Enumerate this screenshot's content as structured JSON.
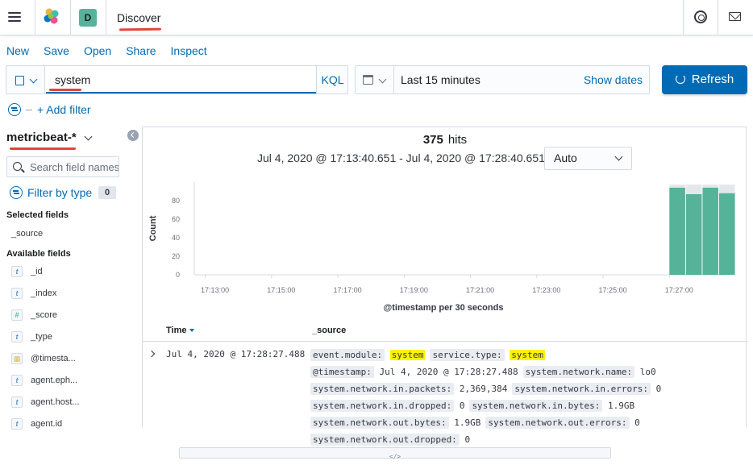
{
  "header": {
    "breadcrumb": "Discover",
    "space_initial": "D"
  },
  "toolbar": {
    "new": "New",
    "save": "Save",
    "open": "Open",
    "share": "Share",
    "inspect": "Inspect"
  },
  "query": {
    "value": "system",
    "language": "KQL"
  },
  "time": {
    "range": "Last 15 minutes",
    "show_dates": "Show dates",
    "refresh": "Refresh"
  },
  "filters": {
    "add": "+ Add filter"
  },
  "sidebar": {
    "index_pattern": "metricbeat-*",
    "search_placeholder": "Search field names",
    "filter_by_type": "Filter by type",
    "filter_count": "0",
    "selected_heading": "Selected fields",
    "available_heading": "Available fields",
    "selected": [
      {
        "name": "_source",
        "type": "source"
      }
    ],
    "available": [
      {
        "name": "_id",
        "type": "t"
      },
      {
        "name": "_index",
        "type": "t"
      },
      {
        "name": "_score",
        "type": "#"
      },
      {
        "name": "_type",
        "type": "t"
      },
      {
        "name": "@timesta...",
        "type": "date"
      },
      {
        "name": "agent.eph...",
        "type": "t"
      },
      {
        "name": "agent.host...",
        "type": "t"
      },
      {
        "name": "agent.id",
        "type": "t"
      }
    ]
  },
  "results": {
    "hits_count": "375",
    "hits_label": "hits",
    "date_range": "Jul 4, 2020 @ 17:13:40.651 - Jul 4, 2020 @ 17:28:40.651 —",
    "interval": "Auto"
  },
  "colors": {
    "bar": "#54b399",
    "bar_bg": "#e4e8ed",
    "accent": "#006bb4"
  },
  "chart_data": {
    "type": "bar",
    "ylabel": "Count",
    "xlabel": "@timestamp per 30 seconds",
    "y_ticks": [
      0,
      20,
      40,
      60,
      80
    ],
    "ylim": [
      0,
      100
    ],
    "x_ticks": [
      "17:13:00",
      "17:15:00",
      "17:17:00",
      "17:19:00",
      "17:21:00",
      "17:23:00",
      "17:25:00",
      "17:27:00"
    ],
    "x_range_minutes": [
      12.67,
      28.67
    ],
    "bars": [
      {
        "x": 27.0,
        "value": 94
      },
      {
        "x": 27.5,
        "value": 87
      },
      {
        "x": 28.0,
        "value": 94
      },
      {
        "x": 28.5,
        "value": 88
      }
    ]
  },
  "table": {
    "col_time": "Time",
    "col_source": "_source",
    "rows": [
      {
        "time": "Jul 4, 2020 @ 17:28:27.488",
        "fields": [
          {
            "k": "event.module:",
            "v": "system",
            "hl": true
          },
          {
            "k": "service.type:",
            "v": "system",
            "hl": true
          },
          {
            "k": "@timestamp:",
            "v": "Jul 4, 2020 @ 17:28:27.488",
            "hl": false
          },
          {
            "k": "system.network.name:",
            "v": "lo0",
            "hl": false
          },
          {
            "k": "system.network.in.packets:",
            "v": "2,369,384",
            "hl": false
          },
          {
            "k": "system.network.in.errors:",
            "v": "0",
            "hl": false
          },
          {
            "k": "system.network.in.dropped:",
            "v": "0",
            "hl": false
          },
          {
            "k": "system.network.in.bytes:",
            "v": "1.9GB",
            "hl": false
          },
          {
            "k": "system.network.out.bytes:",
            "v": "1.9GB",
            "hl": false
          },
          {
            "k": "system.network.out.errors:",
            "v": "0",
            "hl": false
          },
          {
            "k": "system.network.out.dropped:",
            "v": "0",
            "hl": false
          }
        ]
      }
    ]
  }
}
